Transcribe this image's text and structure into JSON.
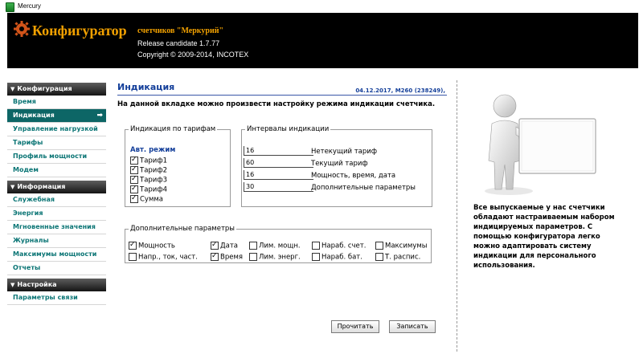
{
  "window": {
    "title": "Mercury"
  },
  "header": {
    "brand": "Конфигуратор",
    "subtitle": "счетчиков \"Меркурий\"",
    "release": "Release candidate 1.7.77",
    "copyright": "Copyright © 2009-2014, INCOTEX"
  },
  "sidebar": {
    "sections": [
      {
        "title": "Конфигурация",
        "items": [
          "Время",
          "Индикация",
          "Управление нагрузкой",
          "Тарифы",
          "Профиль мощности",
          "Модем"
        ]
      },
      {
        "title": "Информация",
        "items": [
          "Служебная",
          "Энергия",
          "Мгновенные значения",
          "Журналы",
          "Максимумы мощности",
          "Отчеты"
        ]
      },
      {
        "title": "Настройка",
        "items": [
          "Параметры связи"
        ]
      }
    ],
    "active_item": "Индикация"
  },
  "main": {
    "title": "Индикация",
    "meta": "04.12.2017, M260 (238249),",
    "intro": "На данной вкладке можно произвести настройку режима индикации счетчика.",
    "tariffs": {
      "legend": "Индикация по тарифам",
      "auto": "Авт. режим",
      "items": [
        {
          "label": "Тариф1",
          "checked": true
        },
        {
          "label": "Тариф2",
          "checked": true
        },
        {
          "label": "Тариф3",
          "checked": true
        },
        {
          "label": "Тариф4",
          "checked": true
        },
        {
          "label": "Сумма",
          "checked": true
        }
      ]
    },
    "intervals": {
      "legend": "Интервалы индикации",
      "rows": [
        {
          "value": "16",
          "label": "Нетекущий тариф"
        },
        {
          "value": "60",
          "label": "Текущий тариф"
        },
        {
          "value": "16",
          "label": "Мощность, время, дата"
        },
        {
          "value": "30",
          "label": "Дополнительные параметры"
        }
      ]
    },
    "extra": {
      "legend": "Дополнительные параметры",
      "row1": [
        {
          "label": "Мощность",
          "checked": true
        },
        {
          "label": "Дата",
          "checked": true
        },
        {
          "label": "Лим. мощн.",
          "checked": false
        },
        {
          "label": "Нараб. счет.",
          "checked": false
        },
        {
          "label": "Максимумы",
          "checked": false
        }
      ],
      "row2": [
        {
          "label": "Напр., ток, част.",
          "checked": false
        },
        {
          "label": "Время",
          "checked": true
        },
        {
          "label": "Лим. энерг.",
          "checked": false
        },
        {
          "label": "Нараб. бат.",
          "checked": false
        },
        {
          "label": "Т. распис.",
          "checked": false
        }
      ]
    }
  },
  "side_panel": {
    "text": "Все выпускаемые у нас счетчики обладают настраиваемым набором индицируемых параметров. С помощью конфигуратора легко можно адаптировать систему индикации для персонального использования."
  },
  "buttons": {
    "read": "Прочитать",
    "write": "Записать"
  },
  "colors": {
    "accent_orange": "#f2a100",
    "teal": "#0d6666",
    "title_blue": "#143f9a"
  }
}
